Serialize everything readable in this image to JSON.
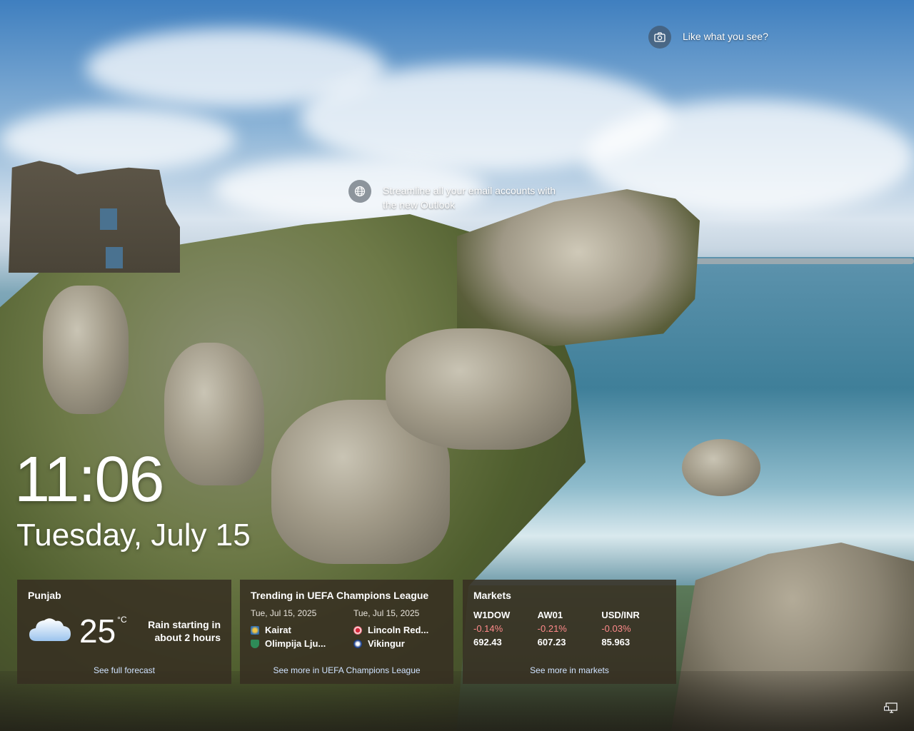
{
  "hotspots": {
    "like_what_you_see": "Like what you see?",
    "outlook_promo_line1": "Streamline all your email accounts with",
    "outlook_promo_line2": "the new Outlook"
  },
  "lockscreen": {
    "time": "11:06",
    "date": "Tuesday, July 15"
  },
  "weather": {
    "location": "Punjab",
    "temperature": "25",
    "unit": "°C",
    "condition_line1": "Rain starting in",
    "condition_line2": "about 2 hours",
    "link": "See full forecast",
    "icon": "cloud-icon"
  },
  "sports": {
    "title": "Trending in UEFA Champions League",
    "matches": [
      {
        "date": "Tue, Jul 15, 2025",
        "team1": "Kairat",
        "team2": "Olimpija Lju..."
      },
      {
        "date": "Tue, Jul 15, 2025",
        "team1": "Lincoln Red...",
        "team2": "Vikingur"
      }
    ],
    "link": "See more in UEFA Champions League"
  },
  "markets": {
    "title": "Markets",
    "items": [
      {
        "name": "W1DOW",
        "change": "-0.14%",
        "value": "692.43"
      },
      {
        "name": "AW01",
        "change": "-0.21%",
        "value": "607.23"
      },
      {
        "name": "USD/INR",
        "change": "-0.03%",
        "value": "85.963"
      }
    ],
    "link": "See more in markets"
  },
  "colors": {
    "negative": "#ff8a8a",
    "card_bg": "#372e22",
    "link": "#cfe2ff"
  }
}
